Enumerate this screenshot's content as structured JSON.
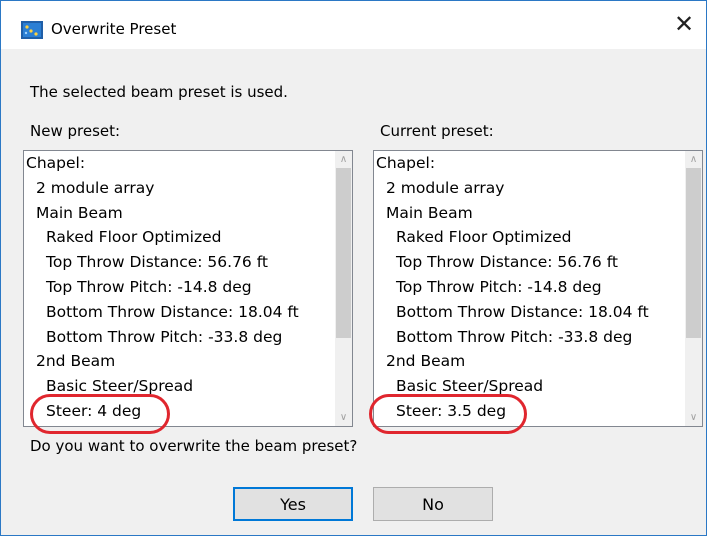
{
  "window": {
    "title": "Overwrite Preset",
    "close_glyph": "✕",
    "icon": "app-icon"
  },
  "message": "The selected beam preset is used.",
  "question": "Do you want to overwrite the beam preset?",
  "new_preset": {
    "label": "New preset:",
    "items": [
      "Chapel:",
      "2 module array",
      "Main Beam",
      "Raked Floor Optimized",
      "Top Throw Distance: 56.76 ft",
      "Top Throw Pitch: -14.8 deg",
      "Bottom Throw Distance: 18.04 ft",
      "Bottom Throw Pitch: -33.8 deg",
      "2nd Beam",
      "Basic Steer/Spread",
      "Steer: 4 deg"
    ]
  },
  "current_preset": {
    "label": "Current preset:",
    "items": [
      "Chapel:",
      "2 module array",
      "Main Beam",
      "Raked Floor Optimized",
      "Top Throw Distance: 56.76 ft",
      "Top Throw Pitch: -14.8 deg",
      "Bottom Throw Distance: 18.04 ft",
      "Bottom Throw Pitch: -33.8 deg",
      "2nd Beam",
      "Basic Steer/Spread",
      "Steer: 3.5 deg"
    ]
  },
  "scroll_arrows": {
    "up": "∧",
    "down": "∨"
  },
  "buttons": {
    "yes": "Yes",
    "no": "No"
  },
  "colors": {
    "highlight": "#e0262e",
    "accent": "#0078d7"
  }
}
